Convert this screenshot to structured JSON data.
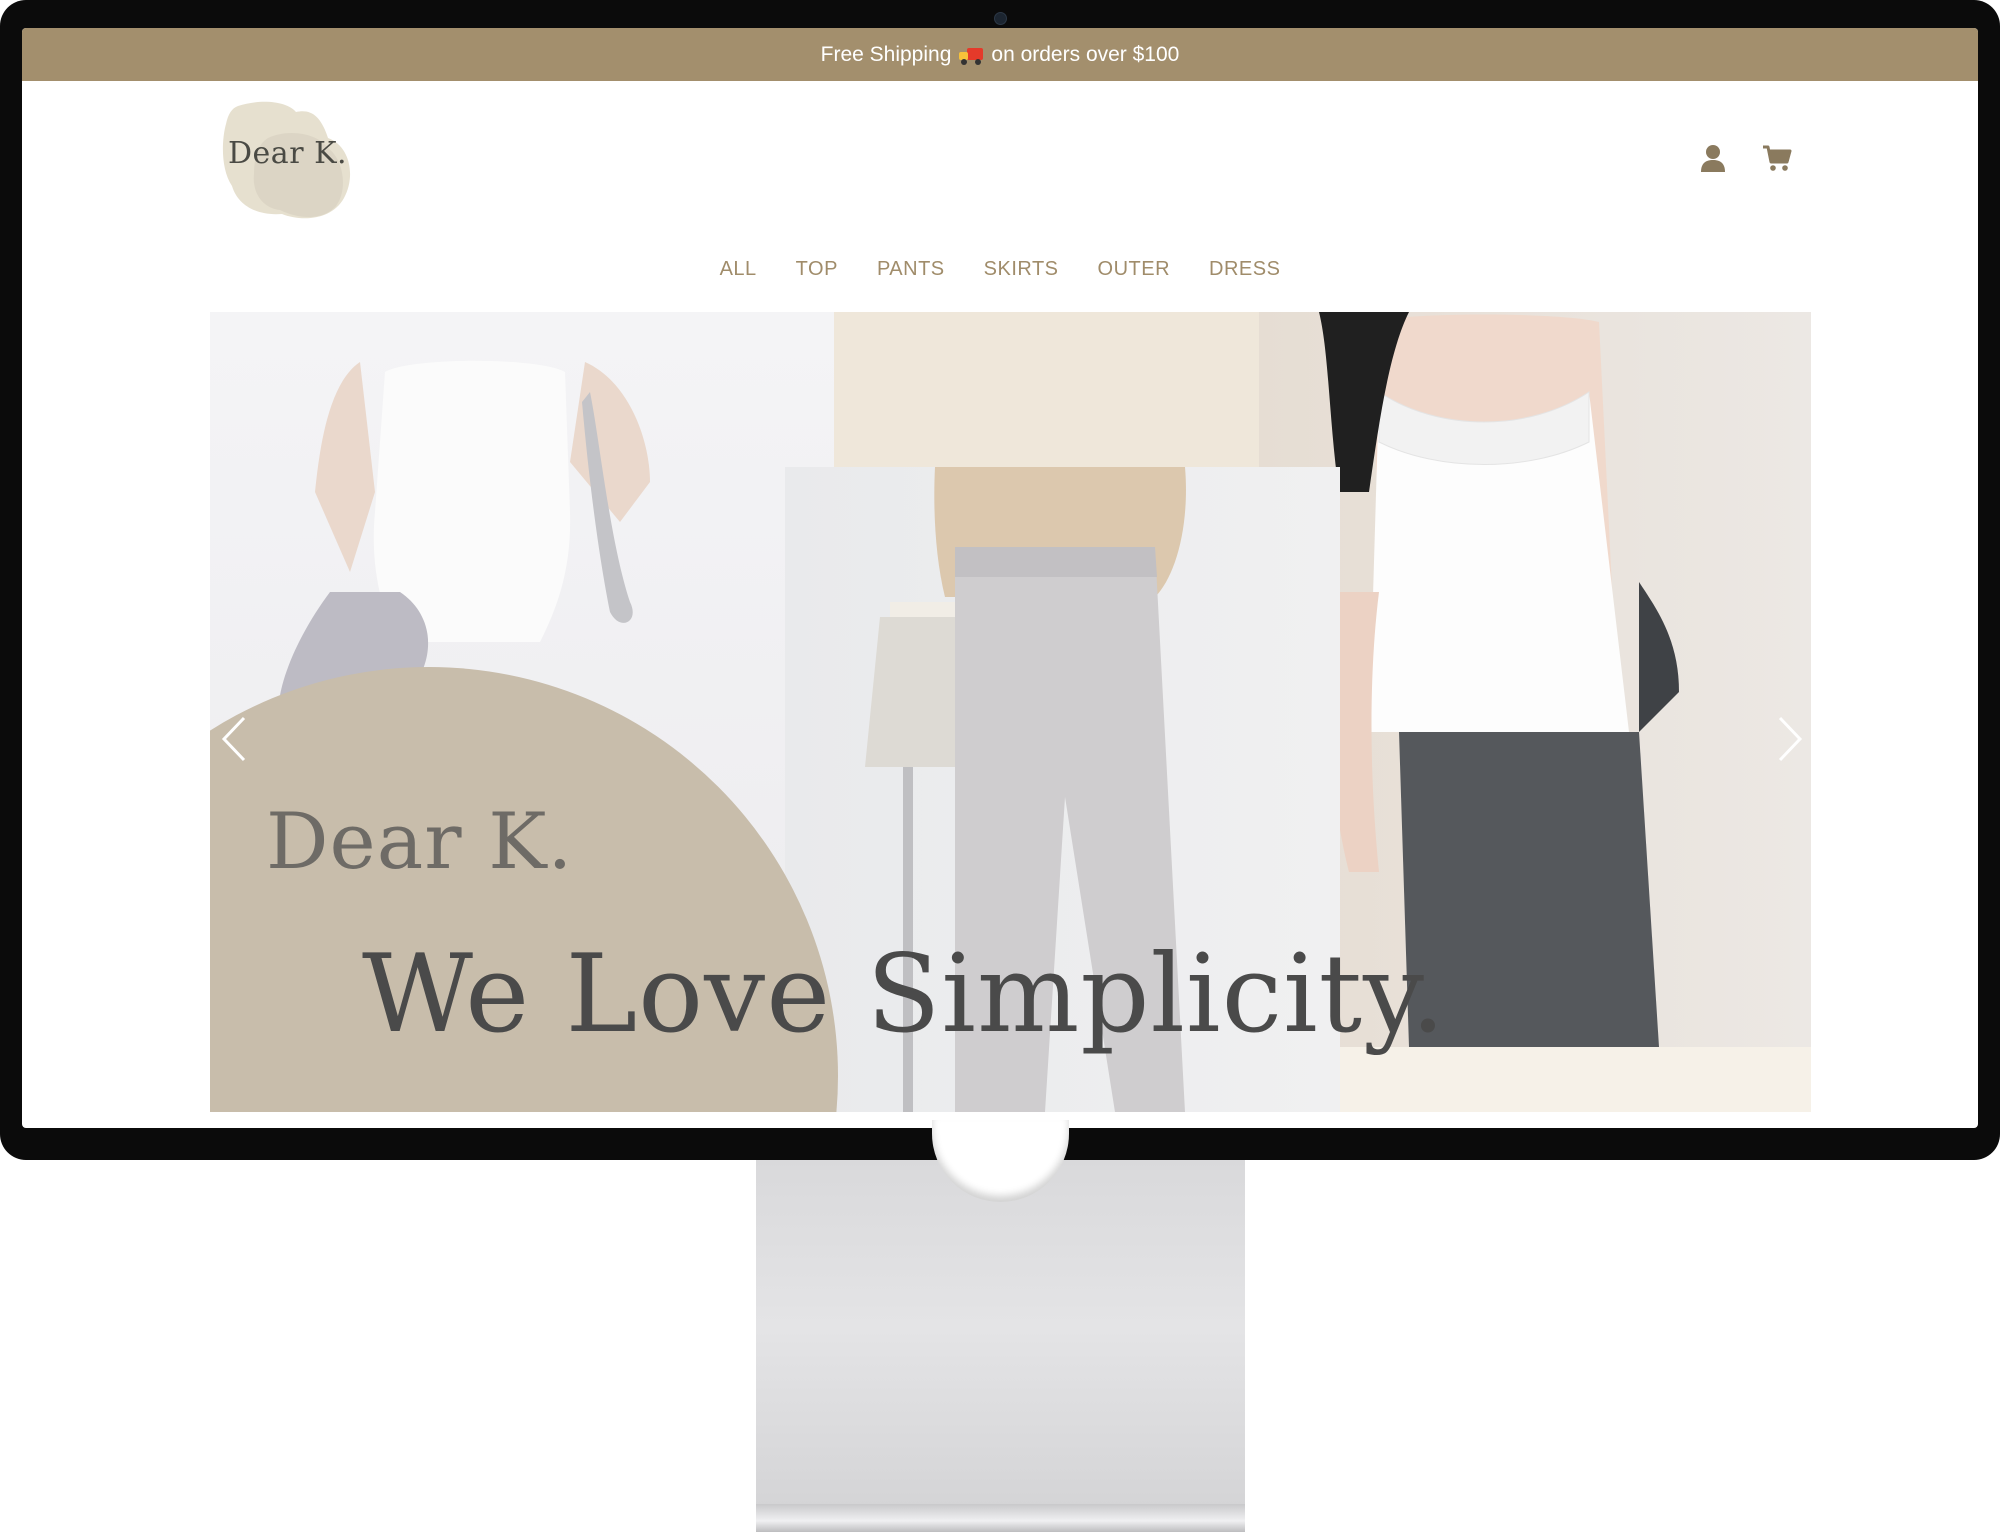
{
  "promo": {
    "text_before": "Free Shipping",
    "text_after": "on orders over $100",
    "icon": "delivery-truck-icon"
  },
  "header": {
    "logo_text": "Dear K.",
    "icons": [
      "user-icon",
      "cart-icon"
    ]
  },
  "nav": {
    "items": [
      "ALL",
      "TOP",
      "PANTS",
      "SKIRTS",
      "OUTER",
      "DRESS"
    ]
  },
  "hero": {
    "brand": "Dear K.",
    "tagline": "We Love Simplicity.",
    "controls": [
      "chevron-left-icon",
      "chevron-right-icon"
    ]
  },
  "colors": {
    "accent": "#a38f6d",
    "nav_text": "#a08c6a",
    "hero_arc": "#c8bdab",
    "hero_text": "#4a4a4a"
  }
}
